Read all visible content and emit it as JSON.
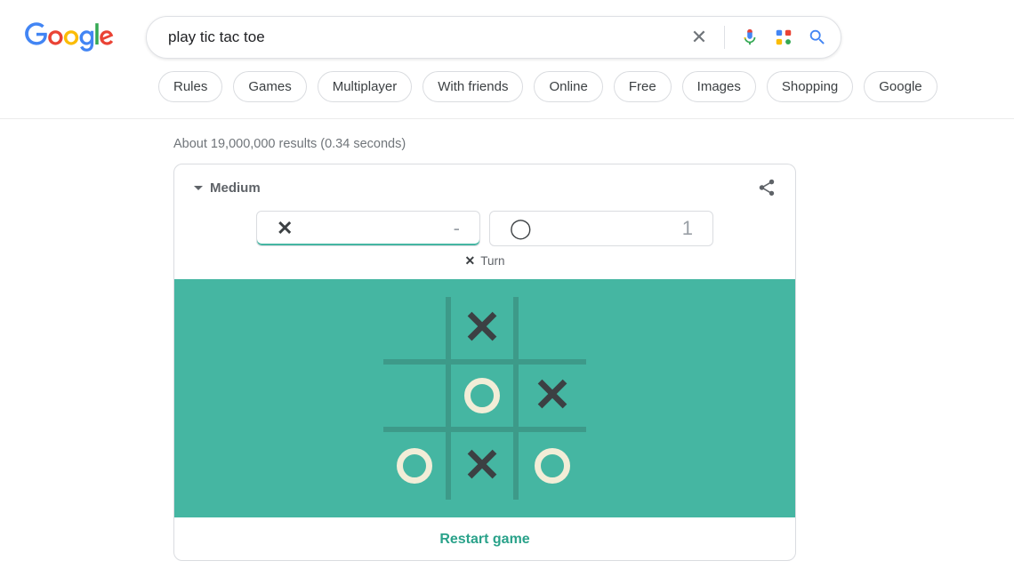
{
  "search": {
    "query": "play tic tac toe",
    "stats": "About 19,000,000 results (0.34 seconds)"
  },
  "chips": [
    "Rules",
    "Games",
    "Multiplayer",
    "With friends",
    "Online",
    "Free",
    "Images",
    "Shopping",
    "Google"
  ],
  "game": {
    "difficulty_label": "Medium",
    "restart_label": "Restart game",
    "turn_label": "Turn",
    "whose_turn_mark": "X",
    "score": {
      "x_mark": "✕",
      "o_mark": "◯",
      "x_value": "-",
      "o_value": "1"
    },
    "board": [
      "",
      "X",
      "",
      "",
      "O",
      "X",
      "O",
      "X",
      "O"
    ],
    "colors": {
      "board_bg": "#45b6a2",
      "o_color": "#f2edd7",
      "x_color": "#3c4043"
    }
  }
}
